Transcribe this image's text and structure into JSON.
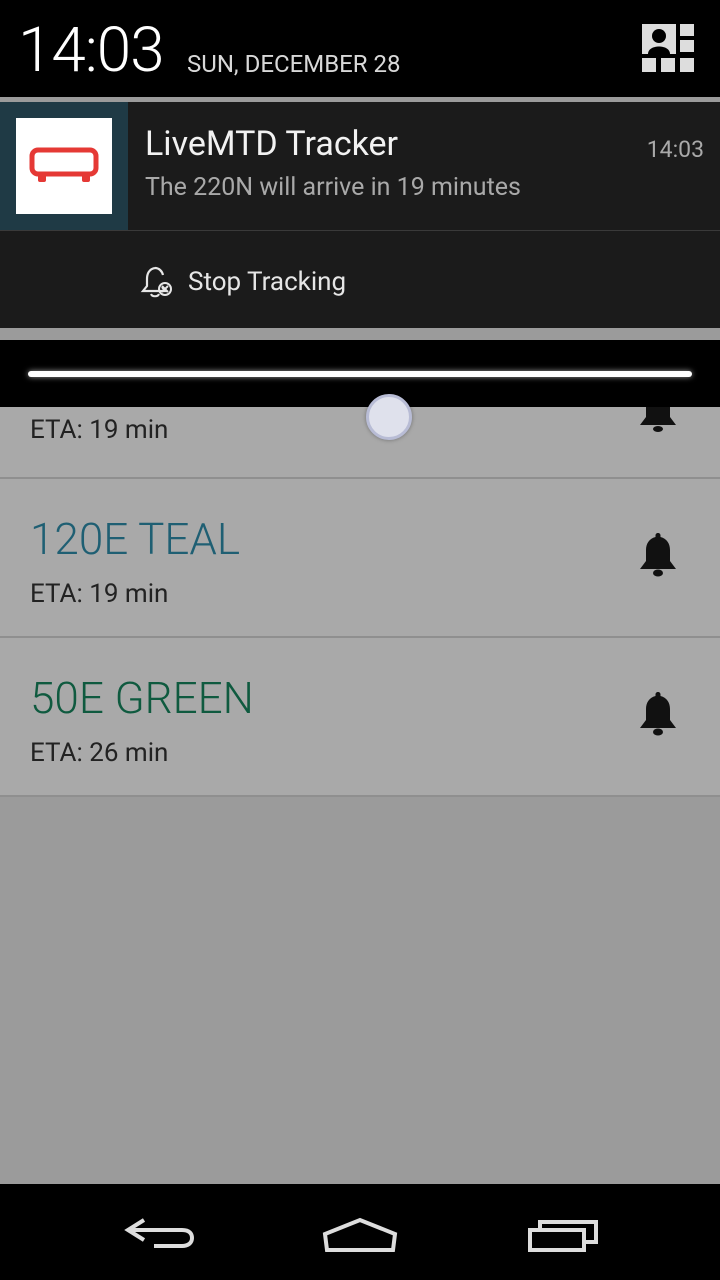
{
  "status": {
    "clock": "14:03",
    "date": "SUN, DECEMBER 28"
  },
  "notification": {
    "app_title": "LiveMTD Tracker",
    "text": "The 220N will arrive in 19 minutes",
    "time": "14:03",
    "action_label": "Stop Tracking",
    "icon": "bus-icon",
    "icon_color": "#e53935"
  },
  "list": {
    "items": [
      {
        "route": "",
        "eta": "ETA: 19 min",
        "color": "#1f5f73"
      },
      {
        "route": "120E TEAL",
        "eta": "ETA: 19 min",
        "color": "#1f5f73"
      },
      {
        "route": "50E GREEN",
        "eta": "ETA: 26 min",
        "color": "#0f5a3f"
      }
    ]
  },
  "navbar": {
    "back": "back-icon",
    "home": "home-icon",
    "recents": "recents-icon"
  }
}
